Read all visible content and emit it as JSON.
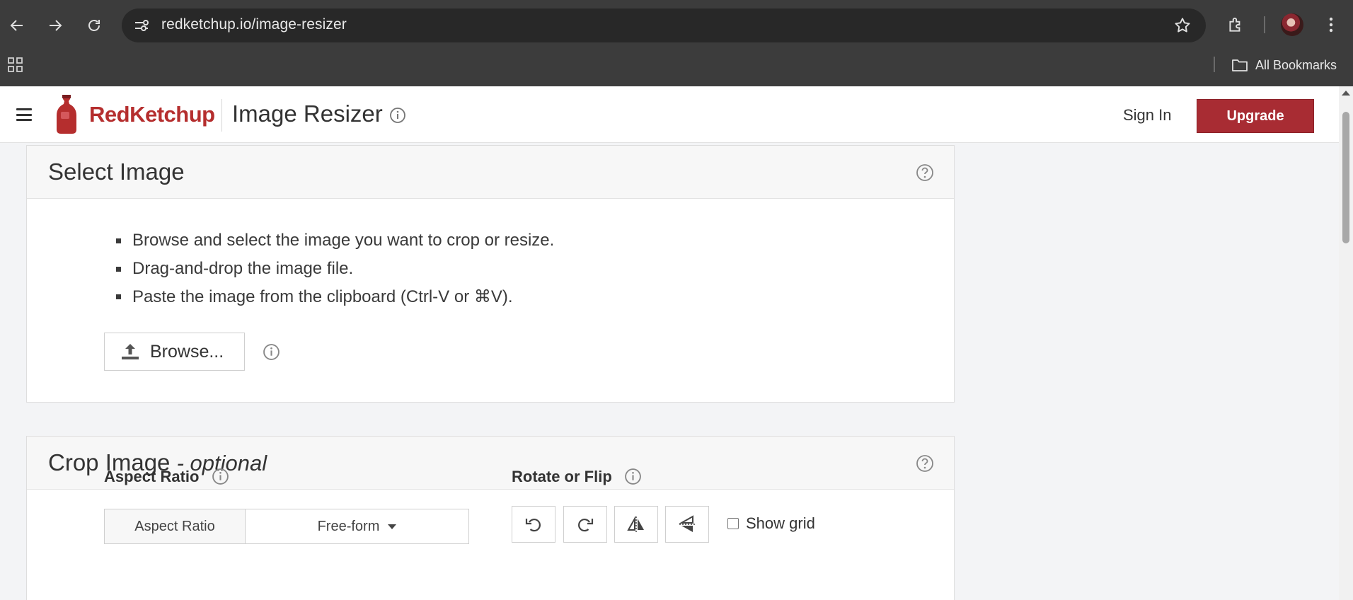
{
  "browser": {
    "url": "redketchup.io/image-resizer",
    "bookmarks_label": "All Bookmarks"
  },
  "header": {
    "brand": "RedKetchup",
    "title": "Image Resizer",
    "sign_in": "Sign In",
    "upgrade": "Upgrade",
    "accent_color": "#a82c33"
  },
  "select_image": {
    "title": "Select Image",
    "bullets": [
      "Browse and select the image you want to crop or resize.",
      "Drag-and-drop the image file.",
      "Paste the image from the clipboard (Ctrl-V or ⌘V)."
    ],
    "browse_label": "Browse..."
  },
  "crop_image": {
    "title": "Crop Image",
    "title_suffix": "- optional",
    "aspect_ratio_heading": "Aspect Ratio",
    "aspect_ratio_label": "Aspect Ratio",
    "aspect_ratio_value": "Free-form",
    "rotate_heading": "Rotate or Flip",
    "show_grid_label": "Show grid",
    "show_grid_checked": false
  },
  "icons": [
    "back-icon",
    "forward-icon",
    "reload-icon",
    "site-info-icon",
    "star-icon",
    "extensions-icon",
    "more-icon",
    "apps-icon",
    "folder-icon",
    "menu-icon",
    "info-icon",
    "help-icon",
    "upload-icon",
    "rotate-left-icon",
    "rotate-right-icon",
    "flip-horizontal-icon",
    "flip-vertical-icon"
  ]
}
